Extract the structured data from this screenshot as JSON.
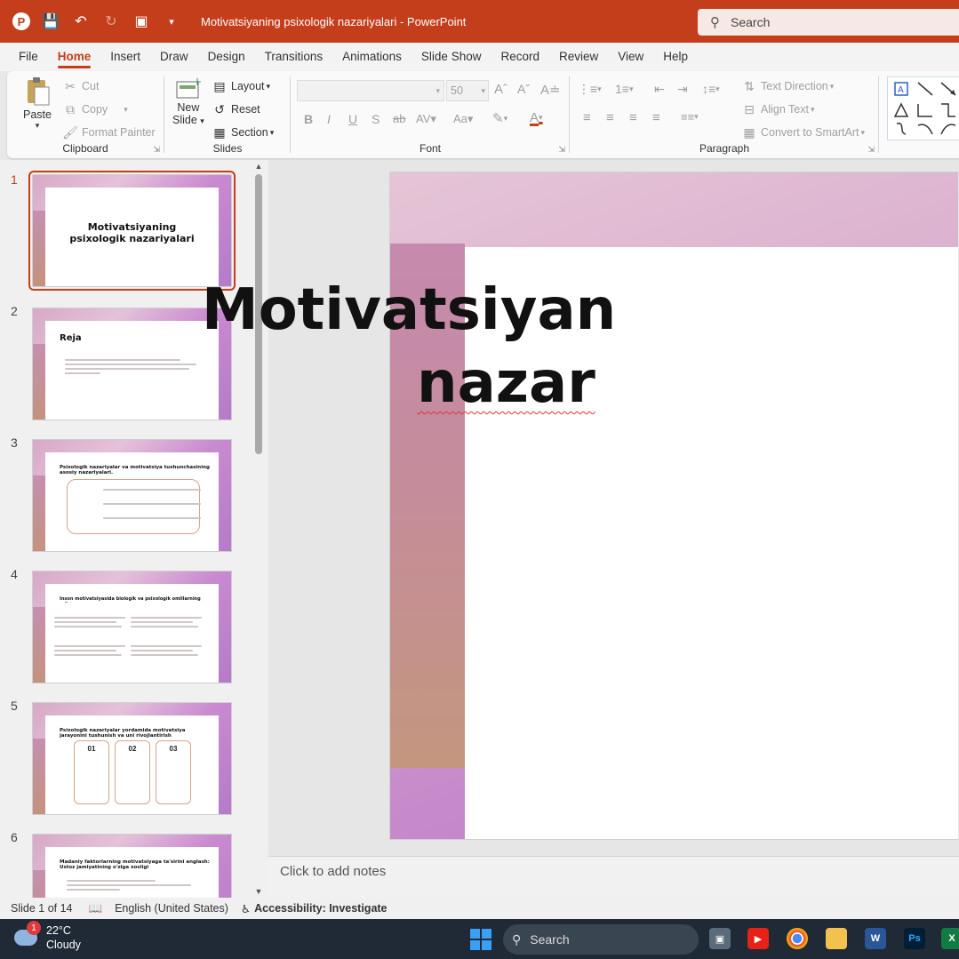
{
  "titlebar": {
    "doc_title": "Motivatsiyaning psixologik nazariyalari  -  PowerPoint",
    "search_placeholder": "Search"
  },
  "menu": [
    "File",
    "Home",
    "Insert",
    "Draw",
    "Design",
    "Transitions",
    "Animations",
    "Slide Show",
    "Record",
    "Review",
    "View",
    "Help"
  ],
  "ribbon": {
    "clipboard": {
      "label": "Clipboard",
      "paste": "Paste",
      "cut": "Cut",
      "copy": "Copy",
      "format_painter": "Format Painter"
    },
    "slides": {
      "label": "Slides",
      "new_slide": "New",
      "new_slide2": "Slide",
      "layout": "Layout",
      "reset": "Reset",
      "section": "Section"
    },
    "font": {
      "label": "Font",
      "size": "50"
    },
    "paragraph": {
      "label": "Paragraph",
      "text_direction": "Text Direction",
      "align_text": "Align Text",
      "convert_smartart": "Convert to SmartArt"
    }
  },
  "thumbnails": [
    {
      "num": "1",
      "title": "Motivatsiyaning psixologik nazariyalari"
    },
    {
      "num": "2",
      "title": "Reja"
    },
    {
      "num": "3",
      "title": "Psixologik nazariyalar va motivatsiya tushunchasining asosiy nazariyalari."
    },
    {
      "num": "4",
      "title": "Inson motivatsiyasida biologik va psixologik omillarning roli."
    },
    {
      "num": "5",
      "title": "Psixologik nazariyalar yordamida motivatsiya jarayonini tushunish va uni rivojlantirish"
    },
    {
      "num": "6",
      "title": "Madaniy faktorlarning motivatsiyaga ta'sirini anglash: Ustoz jamiyatining o'ziga xosligi"
    }
  ],
  "slide5_cards": [
    "01",
    "02",
    "03"
  ],
  "slide": {
    "title_line1": "Motivatsiyan",
    "title_line2": "nazar"
  },
  "notes_placeholder": "Click to add notes",
  "status": {
    "slide_counter": "Slide 1 of 14",
    "language": "English (United States)",
    "accessibility": "Accessibility: Investigate"
  },
  "taskbar": {
    "temp": "22°C",
    "condition": "Cloudy",
    "notification_count": "1",
    "search": "Search"
  }
}
